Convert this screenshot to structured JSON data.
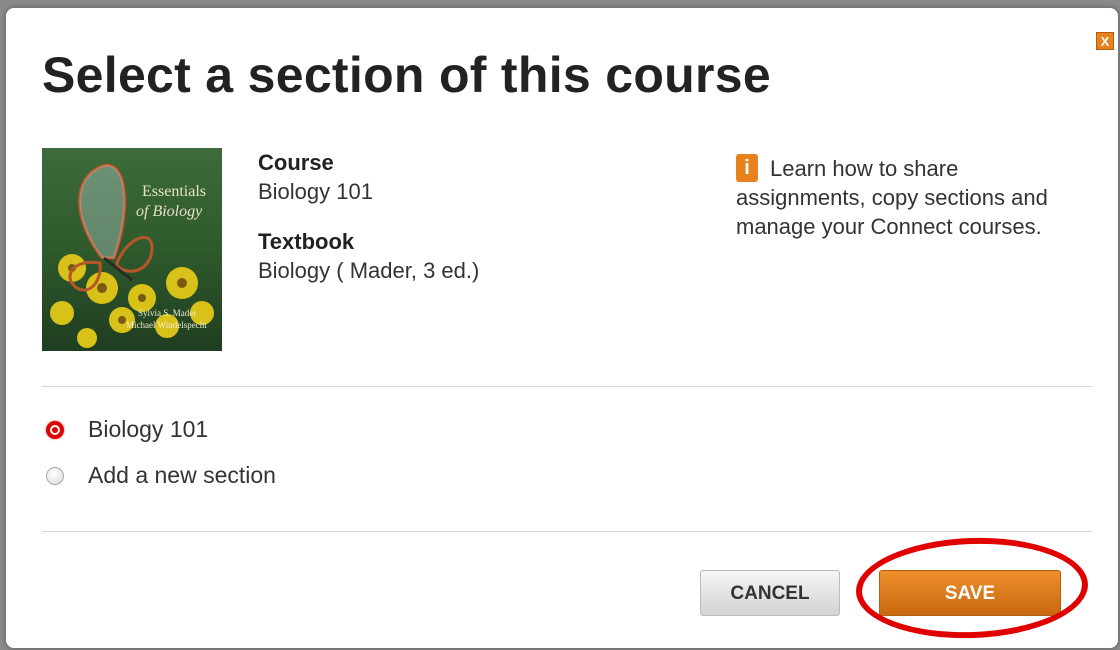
{
  "dialog": {
    "title": "Select a section of this course",
    "close_label": "X"
  },
  "book": {
    "cover_title_line1": "Essentials",
    "cover_title_line2": "of Biology",
    "cover_author1": "Sylvia S. Mader",
    "cover_author2": "Michael Windelspecht"
  },
  "course_info": {
    "course_label": "Course",
    "course_value": "Biology 101",
    "textbook_label": "Textbook",
    "textbook_value": "Biology ( Mader, 3 ed.)"
  },
  "help": {
    "icon": "info-icon",
    "icon_glyph": "i",
    "text": "Learn how to share assignments, copy sections and manage your Connect courses."
  },
  "sections": {
    "options": [
      {
        "label": "Biology 101",
        "selected": true
      },
      {
        "label": "Add a new section",
        "selected": false
      }
    ]
  },
  "buttons": {
    "cancel_label": "CANCEL",
    "save_label": "SAVE"
  },
  "colors": {
    "accent": "#e8821e",
    "highlight": "#e00000"
  }
}
